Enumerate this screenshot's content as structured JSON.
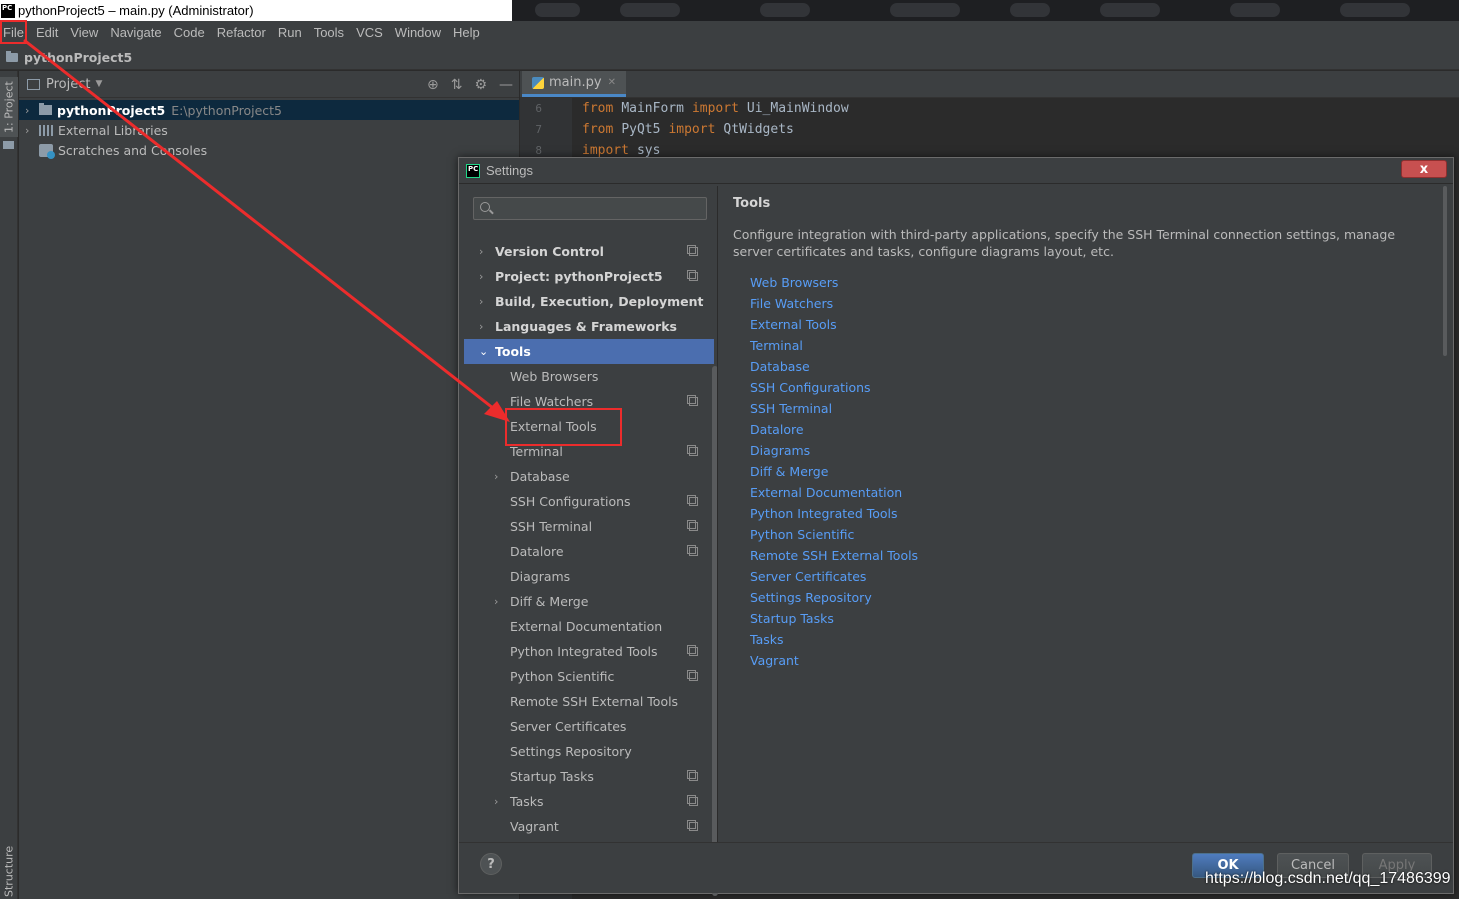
{
  "window": {
    "title": "pythonProject5 – main.py (Administrator)",
    "logo_text": "PC"
  },
  "menu": [
    "File",
    "Edit",
    "View",
    "Navigate",
    "Code",
    "Refactor",
    "Run",
    "Tools",
    "VCS",
    "Window",
    "Help"
  ],
  "nav": {
    "breadcrumb": "pythonProject5"
  },
  "side_tabs": {
    "project": "1: Project",
    "structure": "Structure"
  },
  "project_panel": {
    "header": "Project",
    "tree": [
      {
        "name": "pythonProject5",
        "path": "E:\\pythonProject5"
      },
      {
        "name": "External Libraries"
      },
      {
        "name": "Scratches and Consoles"
      }
    ]
  },
  "editor": {
    "tab": "main.py",
    "lines": [
      {
        "num": "6",
        "t1": "from",
        "t2": "MainForm",
        "t3": "import",
        "t4": "Ui_MainWindow"
      },
      {
        "num": "7",
        "t1": "from",
        "t2": "PyQt5",
        "t3": "import",
        "t4": "QtWidgets"
      },
      {
        "num": "8",
        "t1": "import",
        "t2": "sys",
        "t3": "",
        "t4": ""
      }
    ]
  },
  "settings": {
    "title": "Settings",
    "close": "x",
    "top_items": [
      "Version Control",
      "Project: pythonProject5",
      "Build, Execution, Deployment",
      "Languages & Frameworks",
      "Tools"
    ],
    "sub_items": [
      "Web Browsers",
      "File Watchers",
      "External Tools",
      "Terminal",
      "Database",
      "SSH Configurations",
      "SSH Terminal",
      "Datalore",
      "Diagrams",
      "Diff & Merge",
      "External Documentation",
      "Python Integrated Tools",
      "Python Scientific",
      "Remote SSH External Tools",
      "Server Certificates",
      "Settings Repository",
      "Startup Tasks",
      "Tasks",
      "Vagrant"
    ],
    "content": {
      "heading": "Tools",
      "description": "Configure integration with third-party applications, specify the SSH Terminal connection settings, manage server certificates and tasks, configure diagrams layout, etc.",
      "links": [
        "Web Browsers",
        "File Watchers",
        "External Tools",
        "Terminal",
        "Database",
        "SSH Configurations",
        "SSH Terminal",
        "Datalore",
        "Diagrams",
        "Diff & Merge",
        "External Documentation",
        "Python Integrated Tools",
        "Python Scientific",
        "Remote SSH External Tools",
        "Server Certificates",
        "Settings Repository",
        "Startup Tasks",
        "Tasks",
        "Vagrant"
      ]
    },
    "buttons": {
      "help": "?",
      "ok": "OK",
      "cancel": "Cancel",
      "apply": "Apply"
    }
  },
  "watermark": "https://blog.csdn.net/qq_17486399",
  "colors": {
    "link": "#589df6",
    "selection": "#4b6eaf",
    "annotation": "#ec2c2c",
    "keyword": "#cc7832"
  }
}
